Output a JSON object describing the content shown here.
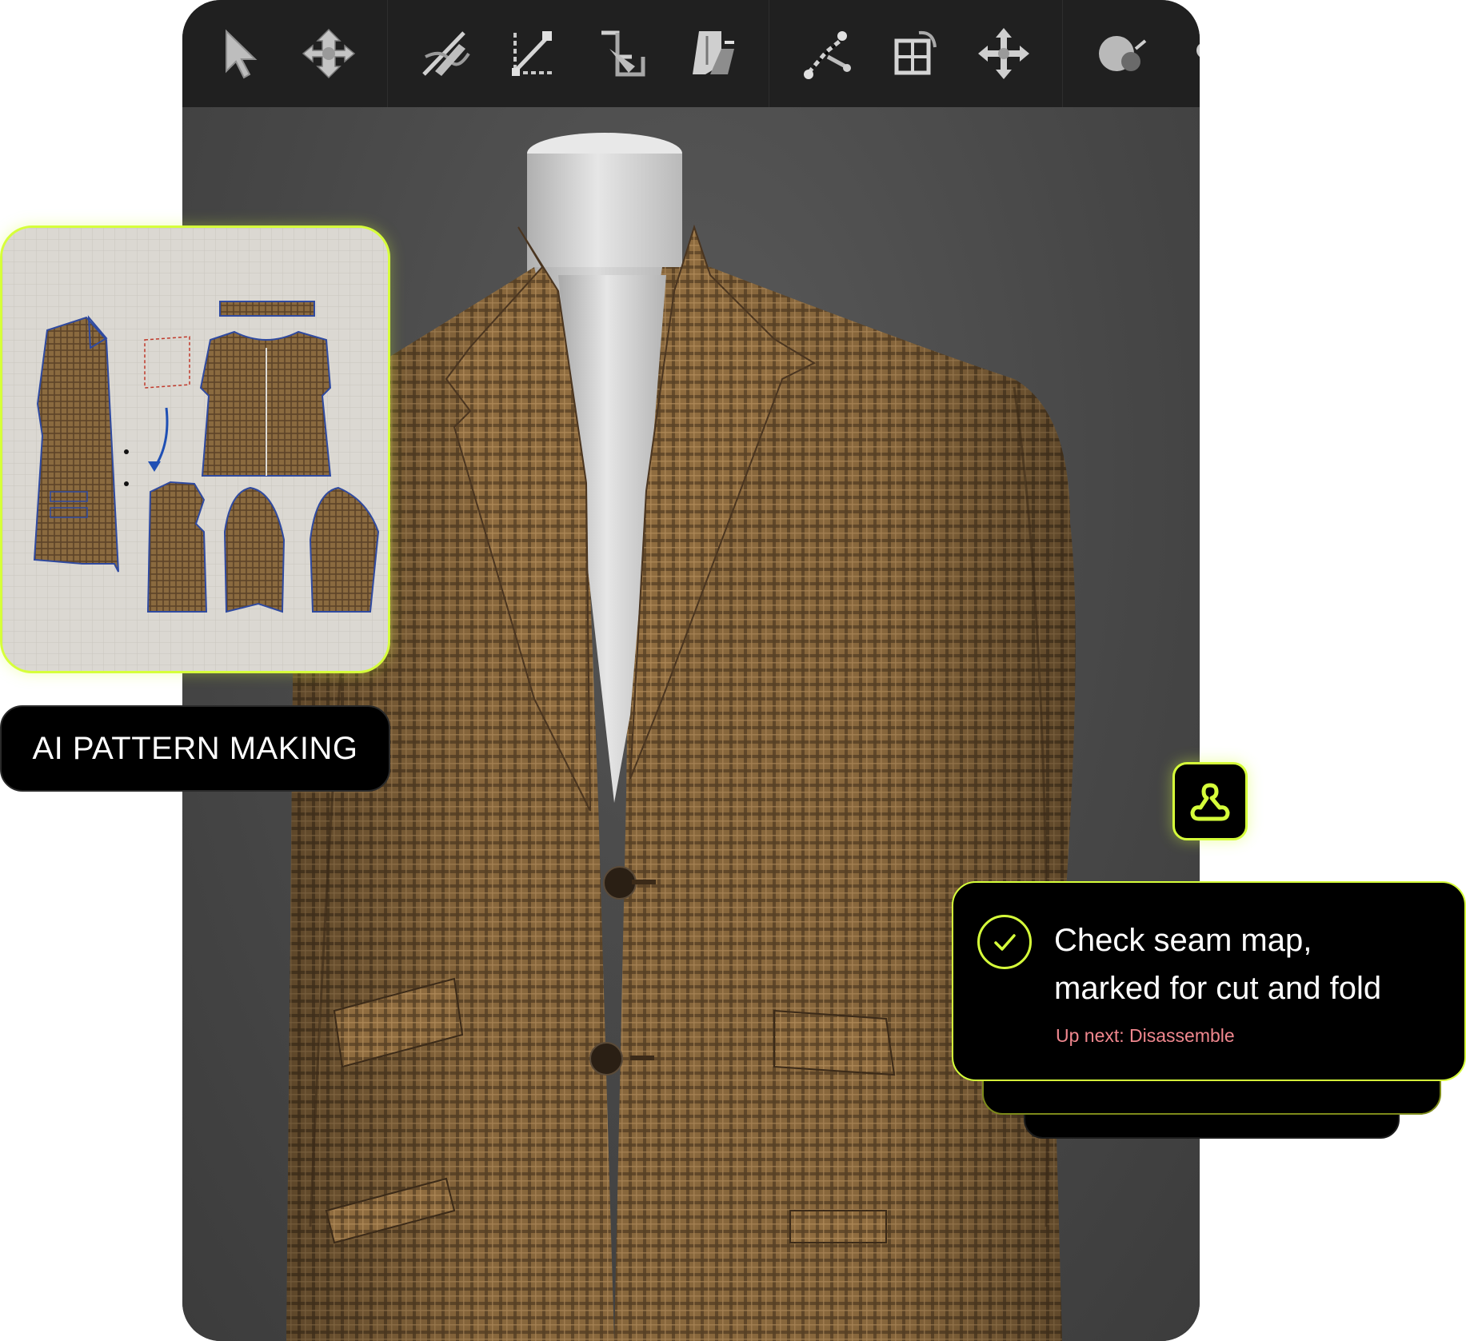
{
  "toolbar": {
    "tools": [
      {
        "icon": "select-arrow-icon"
      },
      {
        "icon": "transform-pattern-icon"
      },
      {
        "icon": "edit-curve-icon"
      },
      {
        "icon": "edit-point-icon"
      },
      {
        "icon": "fold-arrangement-icon"
      },
      {
        "icon": "segment-sewing-icon"
      },
      {
        "icon": "free-sewing-icon"
      },
      {
        "icon": "grid-arrangement-icon"
      },
      {
        "icon": "move-gizmo-icon"
      },
      {
        "icon": "avatar-toggle-icon"
      },
      {
        "icon": "garment-toggle-icon"
      }
    ]
  },
  "pattern_card": {
    "label": "AI PATTERN MAKING"
  },
  "task": {
    "line1": "Check seam map,",
    "line2": "marked for cut and fold",
    "next": "Up next: Disassemble"
  },
  "colors": {
    "accent": "#d6ff3a",
    "fabric": "#8a6a3f",
    "next_text": "#f0878e"
  }
}
